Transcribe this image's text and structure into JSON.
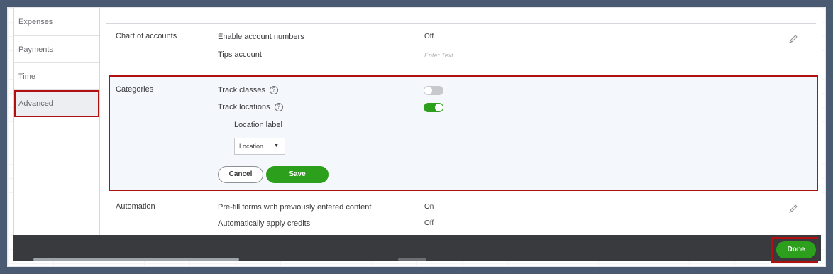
{
  "sidebar": {
    "items": [
      {
        "label": "Expenses"
      },
      {
        "label": "Payments"
      },
      {
        "label": "Time"
      },
      {
        "label": "Advanced"
      }
    ]
  },
  "chart_of_accounts": {
    "title": "Chart of accounts",
    "enable_numbers_label": "Enable account numbers",
    "enable_numbers_value": "Off",
    "tips_label": "Tips account",
    "tips_placeholder": "Enter Text",
    "edit_icon": "pencil-icon"
  },
  "categories": {
    "title": "Categories",
    "track_classes_label": "Track classes",
    "track_classes_state": "off",
    "track_locations_label": "Track locations",
    "track_locations_state": "on",
    "help_glyph": "?",
    "location_label_title": "Location label",
    "location_select_value": "Location",
    "cancel_label": "Cancel",
    "save_label": "Save"
  },
  "automation": {
    "title": "Automation",
    "prefill_label": "Pre-fill forms with previously entered content",
    "prefill_value": "On",
    "apply_credits_label": "Automatically apply credits",
    "apply_credits_value": "Off",
    "edit_icon": "pencil-icon"
  },
  "footer": {
    "done_label": "Done"
  },
  "colors": {
    "accent_green": "#2ca01c",
    "highlight_red": "#b01010",
    "footer_bg": "#393a3d"
  }
}
